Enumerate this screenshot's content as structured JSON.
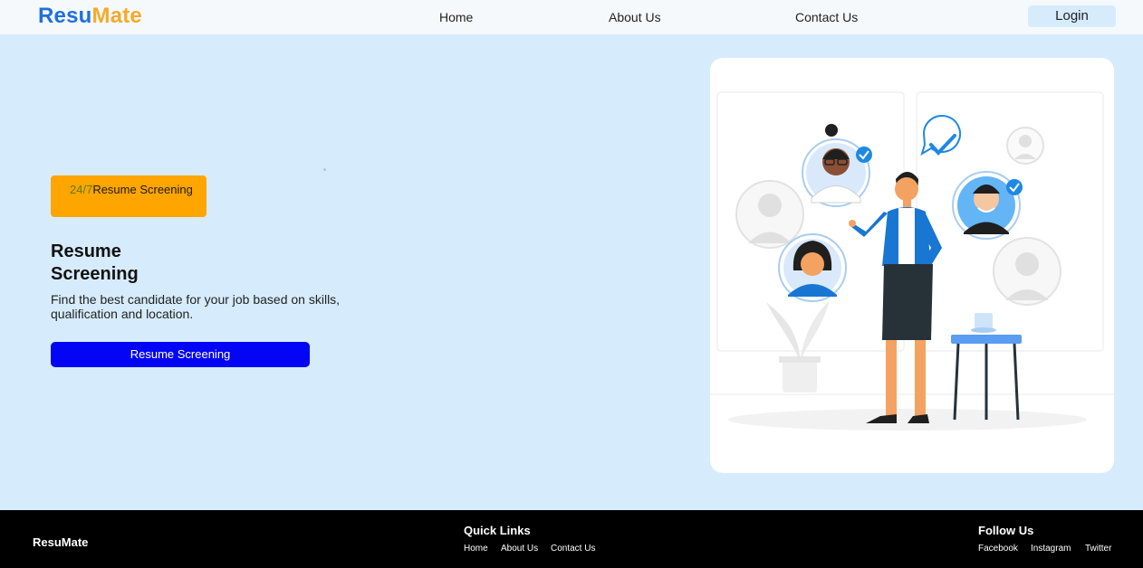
{
  "header": {
    "logo_part1": "Resu",
    "logo_part2": "Mate",
    "nav": [
      "Home",
      "About Us",
      "Contact Us"
    ],
    "login_label": "Login"
  },
  "hero": {
    "badge_highlight": "24/7",
    "badge_text": "Resume Screening",
    "title": "Resume Screening",
    "description": "Find the best candidate for your job based on skills, qualification and location.",
    "cta_label": "Resume Screening"
  },
  "illustration": {
    "icon": "recruiter-illustration",
    "colors": {
      "accent": "#3b82f6",
      "check": "#1e88e5",
      "skin": "#f4a261"
    }
  },
  "footer": {
    "brand": "ResuMate",
    "quick_links_heading": "Quick Links",
    "quick_links": [
      "Home",
      "About Us",
      "Contact Us"
    ],
    "follow_heading": "Follow Us",
    "social": [
      "Facebook",
      "Instagram",
      "Twitter"
    ]
  },
  "colors": {
    "page_bg": "#d6ecfc",
    "header_bg": "#f6f9fc",
    "logo_blue": "#1f6fe0",
    "logo_orange": "#f7a928",
    "badge_bg": "#ffa500",
    "cta_bg": "#0505f5",
    "footer_bg": "#000000"
  }
}
